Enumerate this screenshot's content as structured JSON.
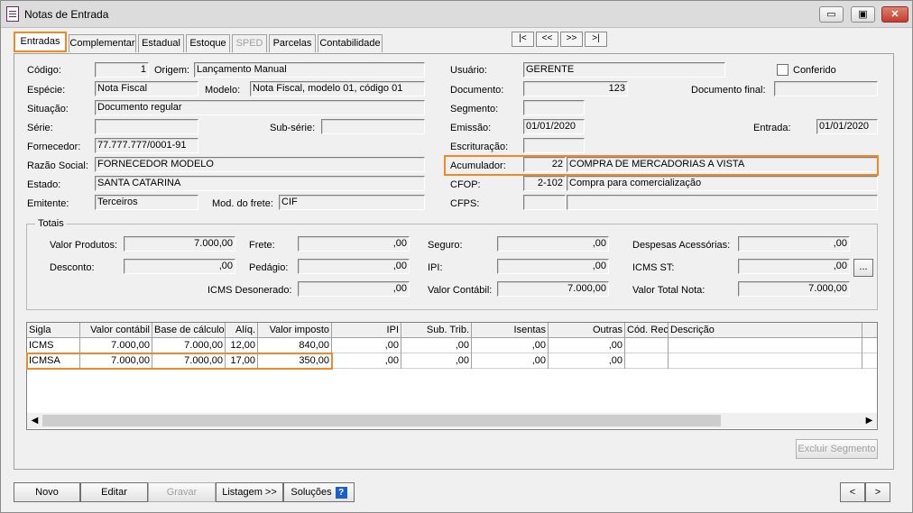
{
  "window": {
    "title": "Notas de Entrada",
    "min": "▭",
    "max": "▣",
    "close": "✕"
  },
  "tabs": [
    "Entradas",
    "Complementar",
    "Estadual",
    "Estoque",
    "SPED",
    "Parcelas",
    "Contabilidade"
  ],
  "nav": [
    "|<",
    "<<",
    ">>",
    ">|"
  ],
  "form": {
    "codigo_label": "Código:",
    "codigo": "1",
    "origem_label": "Origem:",
    "origem": "Lançamento Manual",
    "especie_label": "Espécie:",
    "especie": "Nota Fiscal",
    "modelo_label": "Modelo:",
    "modelo": "Nota Fiscal, modelo 01, código 01",
    "situacao_label": "Situação:",
    "situacao": "Documento regular",
    "serie_label": "Série:",
    "serie": "",
    "subserie_label": "Sub-série:",
    "subserie": "",
    "fornecedor_label": "Fornecedor:",
    "fornecedor": "77.777.777/0001-91",
    "razao_label": "Razão Social:",
    "razao": "FORNECEDOR MODELO",
    "estado_label": "Estado:",
    "estado": "SANTA CATARINA",
    "emitente_label": "Emitente:",
    "emitente": "Terceiros",
    "frete_label": "Mod. do frete:",
    "frete": "CIF",
    "usuario_label": "Usuário:",
    "usuario": "GERENTE",
    "conferido_label": "Conferido",
    "documento_label": "Documento:",
    "documento": "123",
    "docfinal_label": "Documento final:",
    "docfinal": "",
    "segmento_label": "Segmento:",
    "segmento": "",
    "emissao_label": "Emissão:",
    "emissao": "01/01/2020",
    "entrada_label": "Entrada:",
    "entrada": "01/01/2020",
    "escrituracao_label": "Escrituração:",
    "escrituracao": "",
    "acumulador_label": "Acumulador:",
    "acumulador_cod": "22",
    "acumulador_desc": "COMPRA DE MERCADORIAS A VISTA",
    "cfop_label": "CFOP:",
    "cfop_cod": "2-102",
    "cfop_desc": "Compra para comercialização",
    "cfps_label": "CFPS:",
    "cfps_cod": "",
    "cfps_desc": ""
  },
  "totais": {
    "title": "Totais",
    "valor_produtos_label": "Valor Produtos:",
    "valor_produtos": "7.000,00",
    "frete_label": "Frete:",
    "frete": ",00",
    "seguro_label": "Seguro:",
    "seguro": ",00",
    "despesas_label": "Despesas Acessórias:",
    "despesas": ",00",
    "desconto_label": "Desconto:",
    "desconto": ",00",
    "pedagio_label": "Pedágio:",
    "pedagio": ",00",
    "ipi_label": "IPI:",
    "ipi": ",00",
    "icmsst_label": "ICMS ST:",
    "icmsst": ",00",
    "icmsst_btn": "...",
    "icms_desonerado_label": "ICMS Desonerado:",
    "icms_desonerado": ",00",
    "valor_contabil_label": "Valor Contábil:",
    "valor_contabil": "7.000,00",
    "valor_total_label": "Valor Total Nota:",
    "valor_total": "7.000,00"
  },
  "grid": {
    "columns": [
      "Sigla",
      "Valor contábil",
      "Base de cálculo",
      "Alíq.",
      "Valor imposto",
      "IPI",
      "Sub. Trib.",
      "Isentas",
      "Outras",
      "Cód. Rec.",
      "Descrição"
    ],
    "rows": [
      [
        "ICMS",
        "7.000,00",
        "7.000,00",
        "12,00",
        "840,00",
        ",00",
        ",00",
        ",00",
        ",00",
        "",
        ""
      ],
      [
        "ICMSA",
        "7.000,00",
        "7.000,00",
        "17,00",
        "350,00",
        ",00",
        ",00",
        ",00",
        ",00",
        "",
        ""
      ]
    ]
  },
  "buttons": {
    "excluir_segmento": "Excluir Segmento",
    "novo": "Novo",
    "editar": "Editar",
    "gravar": "Gravar",
    "listagem": "Listagem >>",
    "solucoes": "Soluções",
    "help": "?",
    "prev": "<",
    "next": ">"
  },
  "colors": {
    "highlight": "#f08a24",
    "help_blue": "#1a60c8"
  }
}
